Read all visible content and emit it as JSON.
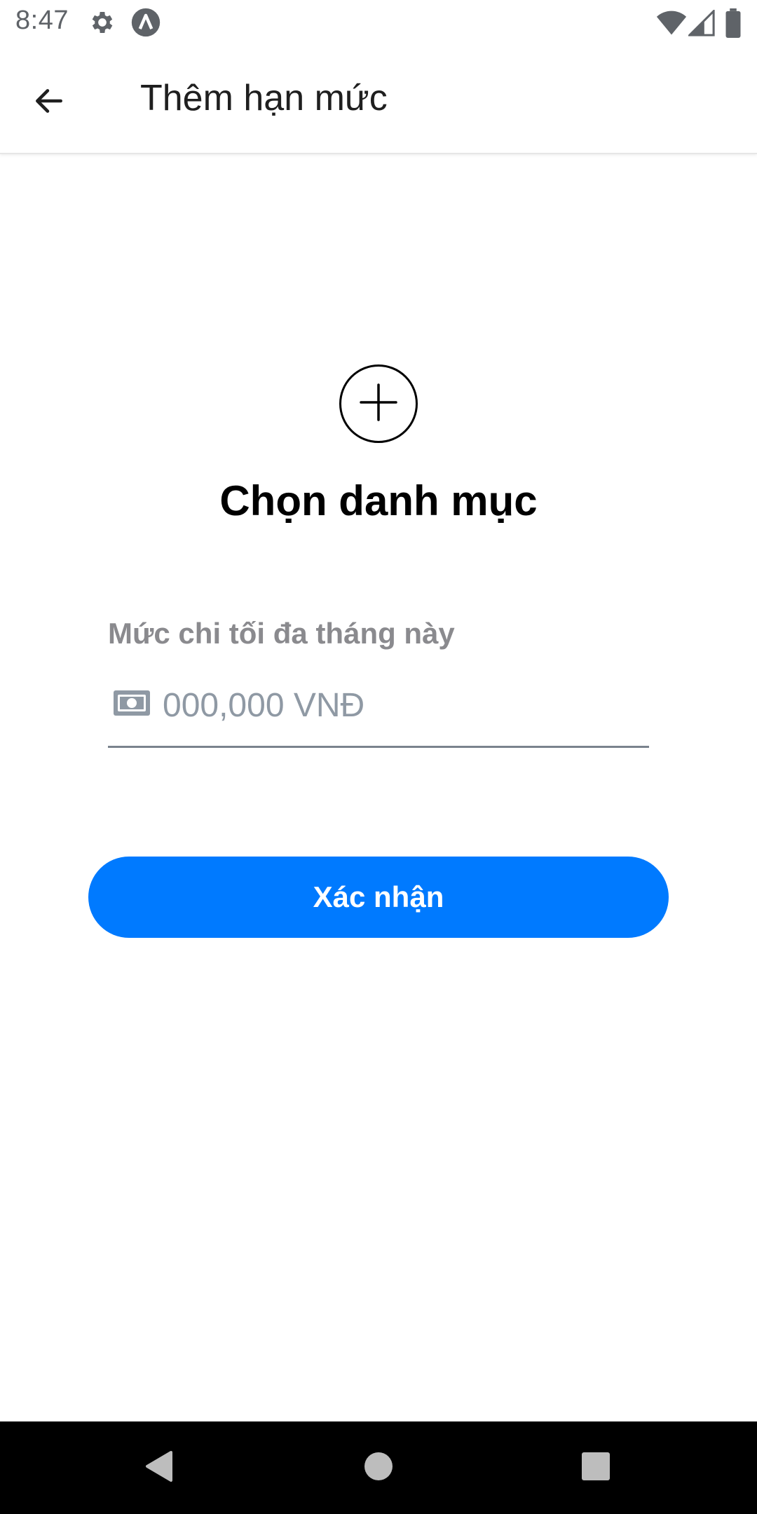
{
  "status_bar": {
    "time": "8:47",
    "icons": [
      "settings-icon",
      "app-notification-icon",
      "wifi-icon",
      "signal-icon",
      "battery-icon"
    ]
  },
  "app_bar": {
    "title": "Thêm hạn mức",
    "back_icon": "arrow-back-icon"
  },
  "category": {
    "icon": "add-circle-icon",
    "label": "Chọn danh mục"
  },
  "amount_field": {
    "label": "Mức chi tối đa tháng này",
    "placeholder": "000,000 VNĐ",
    "value": "",
    "icon": "money-icon"
  },
  "confirm_button": {
    "label": "Xác nhận",
    "color": "#007aff"
  },
  "nav_bar": {
    "icons": [
      "nav-back-icon",
      "nav-home-icon",
      "nav-recents-icon"
    ]
  }
}
